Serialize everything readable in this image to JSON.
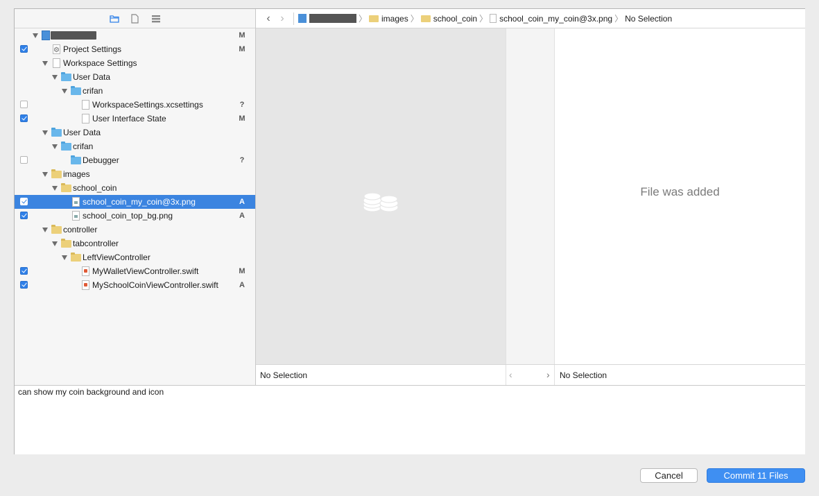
{
  "sidebar": {
    "toolbar_icons": [
      "folder-icon",
      "file-icon",
      "list-icon"
    ],
    "rows": [
      {
        "label": "",
        "status": "M",
        "checked": null,
        "icon": "project-icon",
        "redacted": true
      },
      {
        "label": "Project Settings",
        "status": "M",
        "checked": true,
        "icon": "settings-file-icon"
      },
      {
        "label": "Workspace Settings",
        "status": "",
        "checked": null,
        "icon": "workspace-icon"
      },
      {
        "label": "User Data",
        "status": "",
        "checked": null,
        "icon": "blue-folder-icon"
      },
      {
        "label": "crifan",
        "status": "",
        "checked": null,
        "icon": "blue-folder-icon"
      },
      {
        "label": "WorkspaceSettings.xcsettings",
        "status": "?",
        "checked": false,
        "icon": "file-icon"
      },
      {
        "label": "User Interface State",
        "status": "M",
        "checked": true,
        "icon": "file-icon"
      },
      {
        "label": "User Data",
        "status": "",
        "checked": null,
        "icon": "blue-folder-icon"
      },
      {
        "label": "crifan",
        "status": "",
        "checked": null,
        "icon": "blue-folder-icon"
      },
      {
        "label": "Debugger",
        "status": "?",
        "checked": false,
        "icon": "blue-folder-icon"
      },
      {
        "label": "images",
        "status": "",
        "checked": null,
        "icon": "yellow-folder-icon"
      },
      {
        "label": "school_coin",
        "status": "",
        "checked": null,
        "icon": "yellow-folder-icon"
      },
      {
        "label": "school_coin_my_coin@3x.png",
        "status": "A",
        "checked": true,
        "icon": "png-file-icon"
      },
      {
        "label": "school_coin_top_bg.png",
        "status": "A",
        "checked": true,
        "icon": "png-file-icon"
      },
      {
        "label": "controller",
        "status": "",
        "checked": null,
        "icon": "yellow-folder-icon"
      },
      {
        "label": "tabcontroller",
        "status": "",
        "checked": null,
        "icon": "yellow-folder-icon"
      },
      {
        "label": "LeftViewController",
        "status": "",
        "checked": null,
        "icon": "yellow-folder-icon"
      },
      {
        "label": "MyWalletViewController.swift",
        "status": "M",
        "checked": true,
        "icon": "swift-file-icon"
      },
      {
        "label": "MySchoolCoinViewController.swift",
        "status": "A",
        "checked": true,
        "icon": "swift-file-icon"
      }
    ]
  },
  "jumpbar": {
    "crumbs": [
      "images",
      "school_coin",
      "school_coin_my_coin@3x.png",
      "No Selection"
    ]
  },
  "preview": {
    "added_message": "File was added"
  },
  "footer": {
    "left_selection": "No Selection",
    "right_selection": "No Selection"
  },
  "commit_message": "can show my coin background and icon",
  "buttons": {
    "cancel": "Cancel",
    "commit": "Commit 11 Files"
  }
}
